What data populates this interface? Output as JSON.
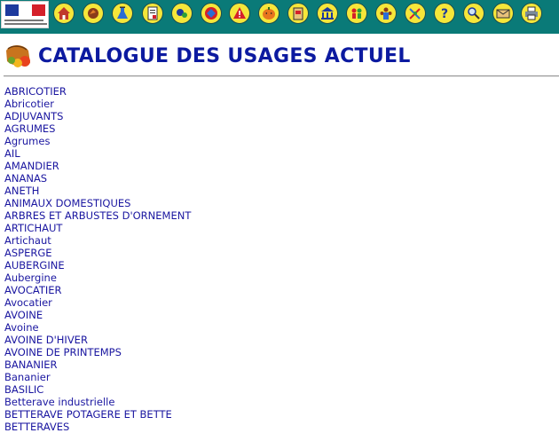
{
  "header": {
    "logo_alt": "République Française",
    "nav_icons": [
      {
        "name": "home-icon"
      },
      {
        "name": "hand-icon"
      },
      {
        "name": "flask-icon"
      },
      {
        "name": "document-icon"
      },
      {
        "name": "search-people-icon"
      },
      {
        "name": "no-entry-icon"
      },
      {
        "name": "warning-icon"
      },
      {
        "name": "pumpkin-icon"
      },
      {
        "name": "clipboard-icon"
      },
      {
        "name": "building-icon"
      },
      {
        "name": "family-icon"
      },
      {
        "name": "group-icon"
      },
      {
        "name": "tools-icon"
      },
      {
        "name": "help-icon"
      },
      {
        "name": "magnifier-icon"
      },
      {
        "name": "mail-icon"
      },
      {
        "name": "print-icon"
      }
    ],
    "nav_button_color": "#f5e63a",
    "bar_color": "#0a7a78"
  },
  "page": {
    "title": "CATALOGUE DES USAGES ACTUEL",
    "title_color": "#0c1aa0",
    "link_color": "#1a16a0"
  },
  "usages": [
    "ABRICOTIER",
    "Abricotier",
    "ADJUVANTS",
    "AGRUMES",
    "Agrumes",
    "AIL",
    "AMANDIER",
    "ANANAS",
    "ANETH",
    "ANIMAUX DOMESTIQUES",
    "ARBRES ET ARBUSTES D'ORNEMENT",
    "ARTICHAUT",
    "Artichaut",
    "ASPERGE",
    "AUBERGINE",
    "Aubergine",
    "AVOCATIER",
    "Avocatier",
    "AVOINE",
    "Avoine",
    "AVOINE D'HIVER",
    "AVOINE DE PRINTEMPS",
    "BANANIER",
    "Bananier",
    "BASILIC",
    "Betterave industrielle",
    "BETTERAVE POTAGERE ET BETTE",
    "BETTERAVES"
  ]
}
